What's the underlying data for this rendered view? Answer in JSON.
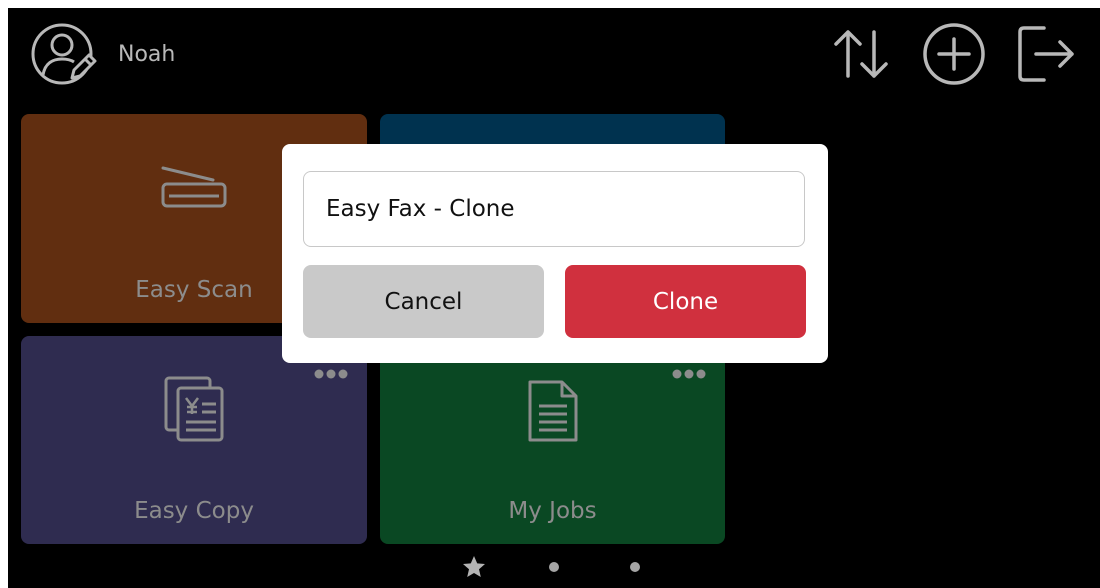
{
  "header": {
    "user_name": "Noah",
    "user_icon": "user-edit-icon",
    "actions": [
      {
        "name": "sort-icon"
      },
      {
        "name": "add-icon"
      },
      {
        "name": "sign-out-icon"
      }
    ]
  },
  "tiles": [
    {
      "label": "Easy Scan",
      "icon": "scanner-icon",
      "color": "#7a3a14"
    },
    {
      "label": "",
      "icon": "",
      "color": "#003f63"
    },
    {
      "label": "Easy Copy",
      "icon": "copy-documents-icon",
      "color": "#3b3765"
    },
    {
      "label": "My Jobs",
      "icon": "document-icon",
      "color": "#0d5a2c"
    }
  ],
  "dialog": {
    "input_value": "Easy Fax - Clone",
    "cancel_label": "Cancel",
    "clone_label": "Clone",
    "clone_color": "#d0303e"
  },
  "pager": {
    "pages": 3,
    "current": 1,
    "first_page_icon": "star-icon"
  }
}
